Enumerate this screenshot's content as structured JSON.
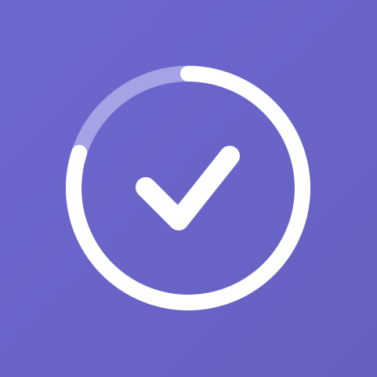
{
  "app": {
    "background_color": "#6a64c8",
    "accent_color": "#ffffff",
    "track_color": "#a9a6e6"
  },
  "progress_indicator": {
    "icon": "check-icon",
    "fill_fraction": 0.8,
    "state": "complete"
  }
}
